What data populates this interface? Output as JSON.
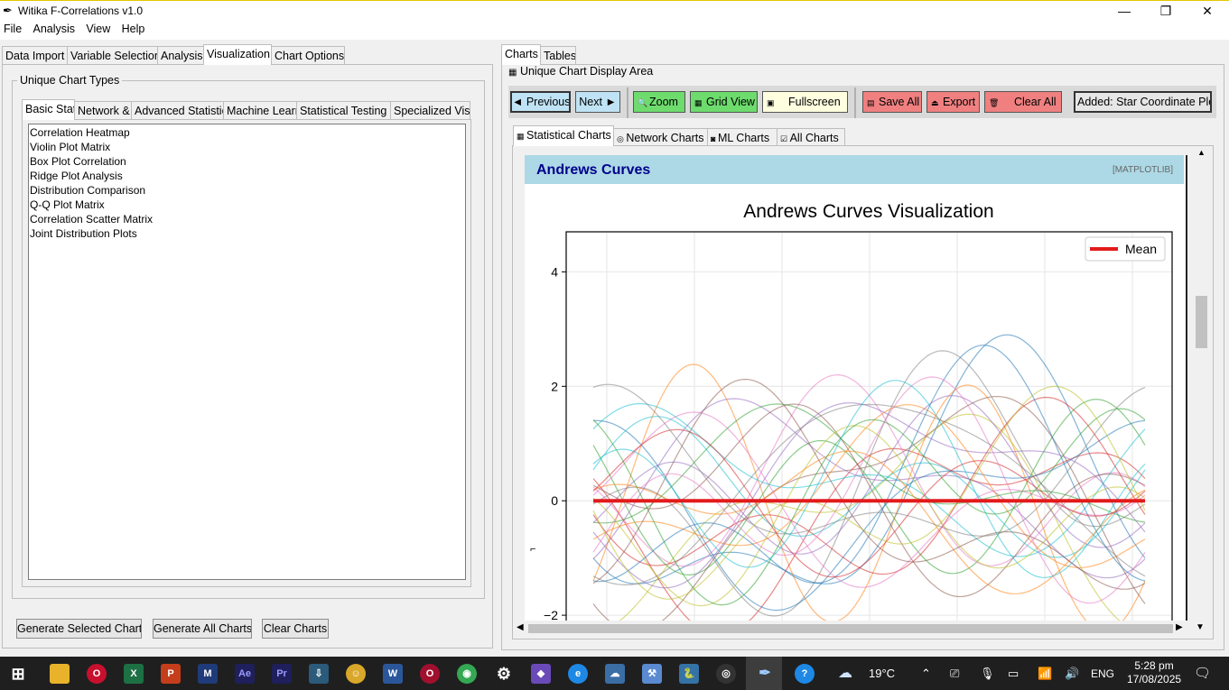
{
  "window": {
    "title": "Witika F-Correlations v1.0"
  },
  "menu": [
    "File",
    "Analysis",
    "View",
    "Help"
  ],
  "main_tabs": [
    "Data Import",
    "Variable Selection",
    "Analysis",
    "Visualization",
    "Chart Options"
  ],
  "left": {
    "group_title": "Unique Chart Types",
    "sub_tabs": [
      "Basic Stati",
      "Network &",
      "Advanced Statistic",
      "Machine Learn",
      "Statistical Testing",
      "Specialized Visu"
    ],
    "chart_types": [
      "Correlation Heatmap",
      "Violin Plot Matrix",
      "Box Plot Correlation",
      "Ridge Plot Analysis",
      "Distribution Comparison",
      "Q-Q Plot Matrix",
      "Correlation Scatter Matrix",
      "Joint Distribution Plots"
    ],
    "buttons": {
      "generate_selected": "Generate Selected Charts",
      "generate_all": "Generate All Charts",
      "clear": "Clear Charts"
    }
  },
  "right": {
    "tabs": [
      "Charts",
      "Tables"
    ],
    "display_area_title": "Unique Chart Display Area",
    "toolbar": {
      "previous": "◄ Previous",
      "next": "Next ►",
      "zoom": "Zoom",
      "grid_view": "Grid View",
      "fullscreen": "Fullscreen",
      "save_all": "Save All",
      "export": "Export",
      "clear_all": "Clear All",
      "status": "Added: Star Coordinate Plot"
    },
    "chart_tabs": [
      "Statistical Charts",
      "Network Charts",
      "ML Charts",
      "All Charts"
    ],
    "card": {
      "title": "Andrews Curves",
      "badge": "[MATPLOTLIB]"
    }
  },
  "colors": {
    "card_header": "#add8e6",
    "card_title": "#00008b",
    "zoom": "#6ddc6d",
    "save": "#f08080",
    "fullscreen": "#ffffe0",
    "prev": "#bfe3f5"
  },
  "chart_data": {
    "type": "line",
    "title": "Andrews Curves Visualization",
    "legend": [
      "Mean"
    ],
    "legend_position": "top-right",
    "y_ticks": [
      "4",
      "2",
      "0",
      "−2"
    ],
    "x_range": [
      -3.14159,
      3.14159
    ],
    "y_range_visible": [
      -2.55,
      4.7
    ],
    "grid": true,
    "mean_value": 0,
    "mean_color": "#e31a1c",
    "series_curves": [
      [
        0.0,
        1.9,
        0.0,
        0.0,
        -1.0
      ],
      [
        0.0,
        -0.2,
        0.0,
        1.7,
        -1.4
      ],
      [
        0.1,
        0.2,
        -0.3,
        -1.2,
        0.6
      ],
      [
        -0.3,
        1.3,
        0.2,
        -0.2,
        0.8
      ],
      [
        0.4,
        -0.9,
        0.7,
        0.3,
        -0.6
      ],
      [
        0.0,
        1.2,
        1.2,
        -0.4,
        -0.6
      ],
      [
        0.2,
        -0.3,
        0.8,
        -0.8,
        0.9
      ],
      [
        0.2,
        1.4,
        0.4,
        1.2,
        0.2
      ],
      [
        -0.4,
        0.6,
        1.2,
        0.3,
        -0.8
      ],
      [
        0.5,
        -0.8,
        -0.4,
        0.4,
        0.5
      ],
      [
        0.0,
        0.9,
        -0.9,
        0.5,
        0.5
      ],
      [
        -0.1,
        0.3,
        1.0,
        0.6,
        0.4
      ],
      [
        0.6,
        -0.6,
        0.5,
        -0.4,
        -0.3
      ],
      [
        -0.2,
        0.9,
        -0.5,
        -0.7,
        -0.6
      ],
      [
        0.3,
        0.5,
        0.3,
        1.0,
        -0.3
      ],
      [
        0.1,
        -1.0,
        0.0,
        -0.9,
        0.2
      ],
      [
        0.0,
        -0.5,
        -0.8,
        0.4,
        -0.7
      ],
      [
        0.4,
        0.4,
        1.5,
        -0.2,
        -0.1
      ],
      [
        -0.5,
        0.2,
        0.6,
        -0.5,
        1.0
      ],
      [
        0.2,
        -0.4,
        -0.2,
        0.9,
        0.2
      ],
      [
        0.0,
        1.5,
        0.4,
        0.6,
        -1.0
      ],
      [
        -0.3,
        -0.7,
        0.3,
        0.0,
        0.7
      ],
      [
        0.3,
        0.8,
        0.0,
        -0.3,
        1.2
      ],
      [
        0.1,
        0.0,
        -0.6,
        0.7,
        -0.5
      ],
      [
        0.5,
        0.7,
        1.1,
        -0.6,
        0.2
      ],
      [
        -0.2,
        -1.3,
        0.4,
        -0.2,
        -0.9
      ],
      [
        0.0,
        0.3,
        0.9,
        1.3,
        0.0
      ],
      [
        0.4,
        -0.2,
        -1.1,
        0.2,
        0.6
      ],
      [
        -0.1,
        1.1,
        -0.2,
        -1.0,
        -0.3
      ],
      [
        0.2,
        0.1,
        0.6,
        0.8,
        1.1
      ]
    ]
  }
}
